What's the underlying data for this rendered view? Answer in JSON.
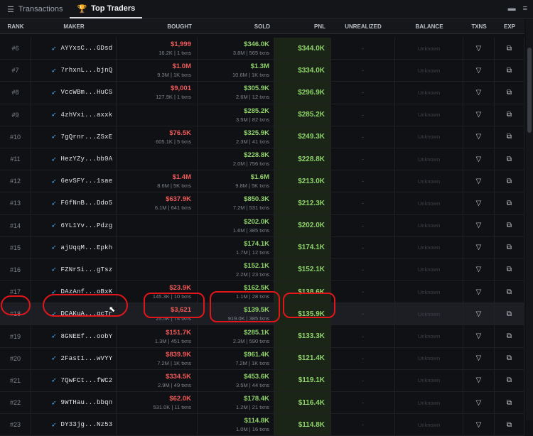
{
  "tabs": [
    {
      "label": "Transactions",
      "icon": "list-icon"
    },
    {
      "label": "Top Traders",
      "icon": "trophy-icon"
    }
  ],
  "window_controls": [
    "minimize-icon",
    "menu-icon"
  ],
  "columns": {
    "rank": "RANK",
    "maker": "MAKER",
    "bought": "BOUGHT",
    "sold": "SOLD",
    "pnl": "PNL",
    "unrealized": "UNREALIZED",
    "balance": "BALANCE",
    "txns": "TXNS",
    "exp": "EXP"
  },
  "placeholders": {
    "dash": "-",
    "unknown": "Unknown"
  },
  "rows": [
    {
      "rank": "#6",
      "maker": "AYYxsC...GDsd",
      "bought": "$1,999",
      "bought_sub": "16.2K | 1 txns",
      "sold": "$346.0K",
      "sold_sub": "3.8M | 565 txns",
      "pnl": "$344.0K"
    },
    {
      "rank": "#7",
      "maker": "7rhxnL...bjnQ",
      "bought": "$1.0M",
      "bought_sub": "9.3M | 1K txns",
      "sold": "$1.3M",
      "sold_sub": "10.6M | 1K txns",
      "pnl": "$334.0K"
    },
    {
      "rank": "#8",
      "maker": "VccWBm...HuCS",
      "bought": "$9,001",
      "bought_sub": "127.9K | 1 txns",
      "sold": "$305.9K",
      "sold_sub": "2.6M | 12 txns",
      "pnl": "$296.9K"
    },
    {
      "rank": "#9",
      "maker": "4zhVxi...axxk",
      "bought": "",
      "bought_sub": "",
      "sold": "$285.2K",
      "sold_sub": "3.5M | 82 txns",
      "pnl": "$285.2K"
    },
    {
      "rank": "#10",
      "maker": "7gQrnr...ZSxE",
      "bought": "$76.5K",
      "bought_sub": "605.1K | 5 txns",
      "sold": "$325.9K",
      "sold_sub": "2.3M | 41 txns",
      "pnl": "$249.3K"
    },
    {
      "rank": "#11",
      "maker": "HezYZy...bb9A",
      "bought": "",
      "bought_sub": "",
      "sold": "$228.8K",
      "sold_sub": "2.0M | 756 txns",
      "pnl": "$228.8K"
    },
    {
      "rank": "#12",
      "maker": "6evSFY...1sae",
      "bought": "$1.4M",
      "bought_sub": "8.6M | 5K txns",
      "sold": "$1.6M",
      "sold_sub": "9.8M | 5K txns",
      "pnl": "$213.0K"
    },
    {
      "rank": "#13",
      "maker": "F6fNnB...Ddo5",
      "bought": "$637.9K",
      "bought_sub": "6.1M | 641 txns",
      "sold": "$850.3K",
      "sold_sub": "7.2M | 531 txns",
      "pnl": "$212.3K"
    },
    {
      "rank": "#14",
      "maker": "6YL1Yv...Pdzg",
      "bought": "",
      "bought_sub": "",
      "sold": "$202.0K",
      "sold_sub": "1.6M | 385 txns",
      "pnl": "$202.0K"
    },
    {
      "rank": "#15",
      "maker": "ajUqqM...Epkh",
      "bought": "",
      "bought_sub": "",
      "sold": "$174.1K",
      "sold_sub": "1.7M | 12 txns",
      "pnl": "$174.1K"
    },
    {
      "rank": "#16",
      "maker": "FZNrSi...gTsz",
      "bought": "",
      "bought_sub": "",
      "sold": "$152.1K",
      "sold_sub": "2.2M | 23 txns",
      "pnl": "$152.1K"
    },
    {
      "rank": "#17",
      "maker": "DAzAnf...oBxK",
      "bought": "$23.9K",
      "bought_sub": "145.3K | 10 txns",
      "sold": "$162.5K",
      "sold_sub": "1.1M | 28 txns",
      "pnl": "$138.6K"
    },
    {
      "rank": "#18",
      "maker": "DCAKuA...gcTr",
      "bought": "$3,621",
      "bought_sub": "25.5K | 74 txns",
      "sold": "$139.5K",
      "sold_sub": "919.0K | 385 txns",
      "pnl": "$135.9K",
      "highlight": true
    },
    {
      "rank": "#19",
      "maker": "8GNEEf...oobY",
      "bought": "$151.7K",
      "bought_sub": "1.3M | 451 txns",
      "sold": "$285.1K",
      "sold_sub": "2.3M | 590 txns",
      "pnl": "$133.3K"
    },
    {
      "rank": "#20",
      "maker": "2Fast1...wVYY",
      "bought": "$839.9K",
      "bought_sub": "7.2M | 1K txns",
      "sold": "$961.4K",
      "sold_sub": "7.2M | 1K txns",
      "pnl": "$121.4K"
    },
    {
      "rank": "#21",
      "maker": "7QwFCt...fWC2",
      "bought": "$334.5K",
      "bought_sub": "2.9M | 49 txns",
      "sold": "$453.6K",
      "sold_sub": "3.5M | 44 txns",
      "pnl": "$119.1K"
    },
    {
      "rank": "#22",
      "maker": "9WTHau...bbqn",
      "bought": "$62.0K",
      "bought_sub": "531.0K | 11 txns",
      "sold": "$178.4K",
      "sold_sub": "1.2M | 21 txns",
      "pnl": "$116.4K"
    },
    {
      "rank": "#23",
      "maker": "DY33jg...Nz53",
      "bought": "",
      "bought_sub": "",
      "sold": "$114.8K",
      "sold_sub": "1.0M | 16 txns",
      "pnl": "$114.8K"
    }
  ],
  "colors": {
    "bought": "#f05a5a",
    "sold": "#8fd36b",
    "annotation": "#e0161b"
  },
  "row_icons": {
    "txns": "filter-icon",
    "exp": "external-link-icon"
  }
}
